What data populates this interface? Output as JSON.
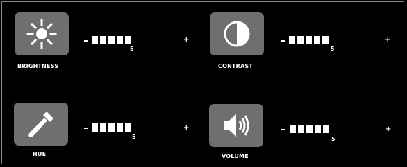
{
  "controls": {
    "brightness": {
      "label": "BRIGHTNESS",
      "level": "5",
      "icon": "sun-icon"
    },
    "contrast": {
      "label": "CONTRAST",
      "level": "5",
      "icon": "contrast-icon"
    },
    "hue": {
      "label": "HUE",
      "level": "5",
      "icon": "dropper-icon"
    },
    "volume": {
      "label": "VOLUME",
      "level": "5",
      "icon": "speaker-icon"
    }
  },
  "buttons": {
    "decrease": "-",
    "increase": "+"
  },
  "colors": {
    "background": "#000000",
    "tile": "#6f6f6f",
    "foreground": "#ffffff",
    "border": "#8a8a8a"
  }
}
